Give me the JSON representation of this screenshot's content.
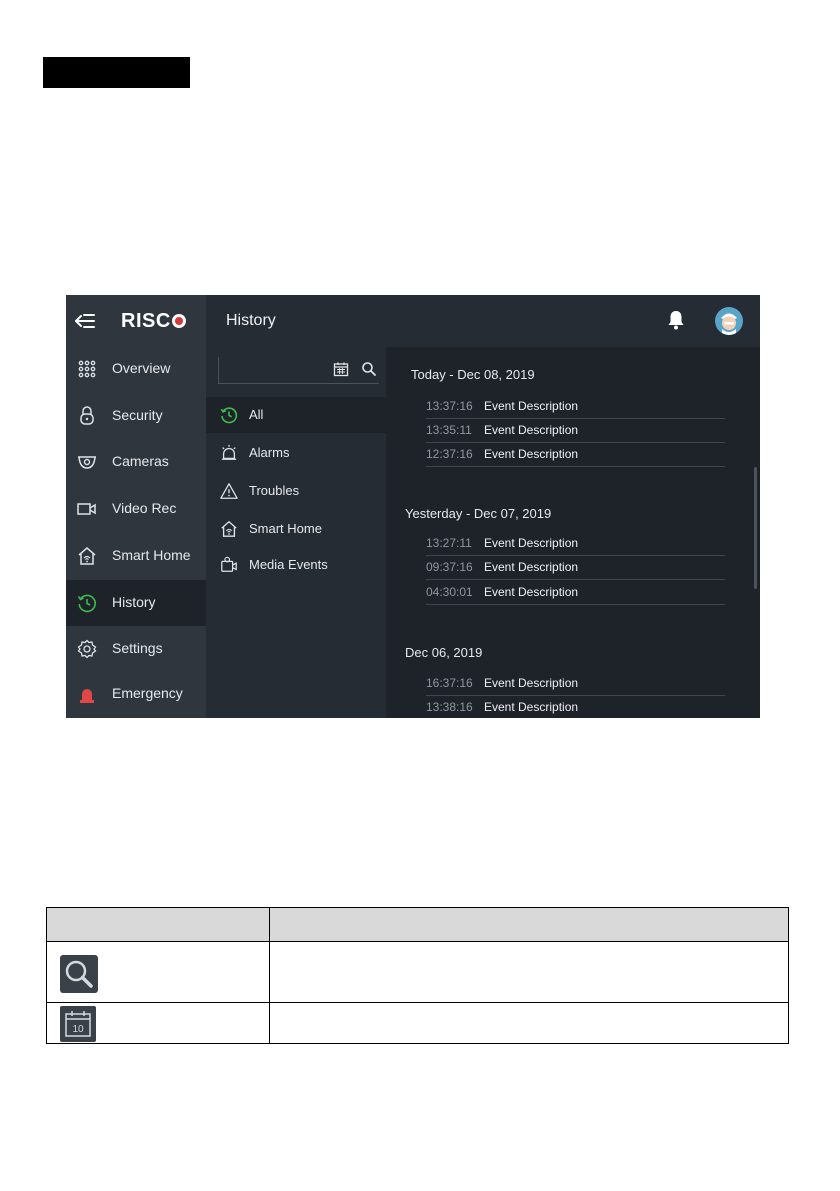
{
  "app": {
    "logo": "RISC",
    "page_title": "History",
    "sidebar": [
      {
        "label": "Overview",
        "icon": "grid-icon"
      },
      {
        "label": "Security",
        "icon": "lock-icon"
      },
      {
        "label": "Cameras",
        "icon": "camera-icon"
      },
      {
        "label": "Video Rec",
        "icon": "video-icon"
      },
      {
        "label": "Smart Home",
        "icon": "smart-home-icon"
      },
      {
        "label": "History",
        "icon": "history-icon",
        "active": true
      },
      {
        "label": "Settings",
        "icon": "gear-icon"
      },
      {
        "label": "Emergency",
        "icon": "emergency-icon"
      }
    ],
    "filters": [
      {
        "label": "All",
        "icon": "history-icon",
        "active": true
      },
      {
        "label": "Alarms",
        "icon": "alarm-icon"
      },
      {
        "label": "Troubles",
        "icon": "warning-icon"
      },
      {
        "label": "Smart Home",
        "icon": "smart-home-icon"
      },
      {
        "label": "Media Events",
        "icon": "media-icon"
      }
    ],
    "days": [
      {
        "title": "Today - Dec 08, 2019",
        "events": [
          {
            "time": "13:37:16",
            "desc": "Event Description"
          },
          {
            "time": "13:35:11",
            "desc": "Event Description"
          },
          {
            "time": "12:37:16",
            "desc": "Event Description"
          }
        ]
      },
      {
        "title": "Yesterday - Dec 07, 2019",
        "events": [
          {
            "time": "13:27:11",
            "desc": "Event Description"
          },
          {
            "time": "09:37:16",
            "desc": "Event Description"
          },
          {
            "time": "04:30:01",
            "desc": "Event Description"
          }
        ]
      },
      {
        "title": "Dec 06, 2019",
        "events": [
          {
            "time": "16:37:16",
            "desc": "Event Description"
          },
          {
            "time": "13:38:16",
            "desc": "Event Description"
          }
        ]
      }
    ],
    "colors": {
      "accent_green": "#3fb950",
      "emergency_red": "#e04848",
      "logo_red": "#d23b3b"
    }
  },
  "table": {
    "rows": [
      {
        "icon": "search-icon"
      },
      {
        "icon": "calendar-icon",
        "icon_text": "10"
      }
    ]
  }
}
